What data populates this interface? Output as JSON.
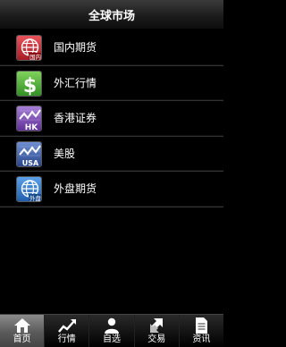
{
  "header": {
    "title": "全球市场"
  },
  "menu": {
    "items": [
      {
        "label": "国内期货",
        "icon": "globe-domestic-icon",
        "icon_text": "国内",
        "color": "#c0262e"
      },
      {
        "label": "外汇行情",
        "icon": "dollar-icon",
        "icon_text": "$",
        "color": "#3aa12e"
      },
      {
        "label": "香港证券",
        "icon": "hk-chart-icon",
        "icon_text": "HK",
        "color": "#6a3aa0"
      },
      {
        "label": "美股",
        "icon": "usa-chart-icon",
        "icon_text": "USA",
        "color": "#2f4f9a"
      },
      {
        "label": "外盘期货",
        "icon": "globe-foreign-icon",
        "icon_text": "外盘",
        "color": "#2a6fc0"
      }
    ]
  },
  "tabbar": {
    "tabs": [
      {
        "label": "首页",
        "icon": "home-icon",
        "active": true
      },
      {
        "label": "行情",
        "icon": "trend-chart-icon",
        "active": false
      },
      {
        "label": "自选",
        "icon": "person-icon",
        "active": false
      },
      {
        "label": "交易",
        "icon": "exchange-arrows-icon",
        "active": false
      },
      {
        "label": "资讯",
        "icon": "document-icon",
        "active": false
      }
    ]
  }
}
